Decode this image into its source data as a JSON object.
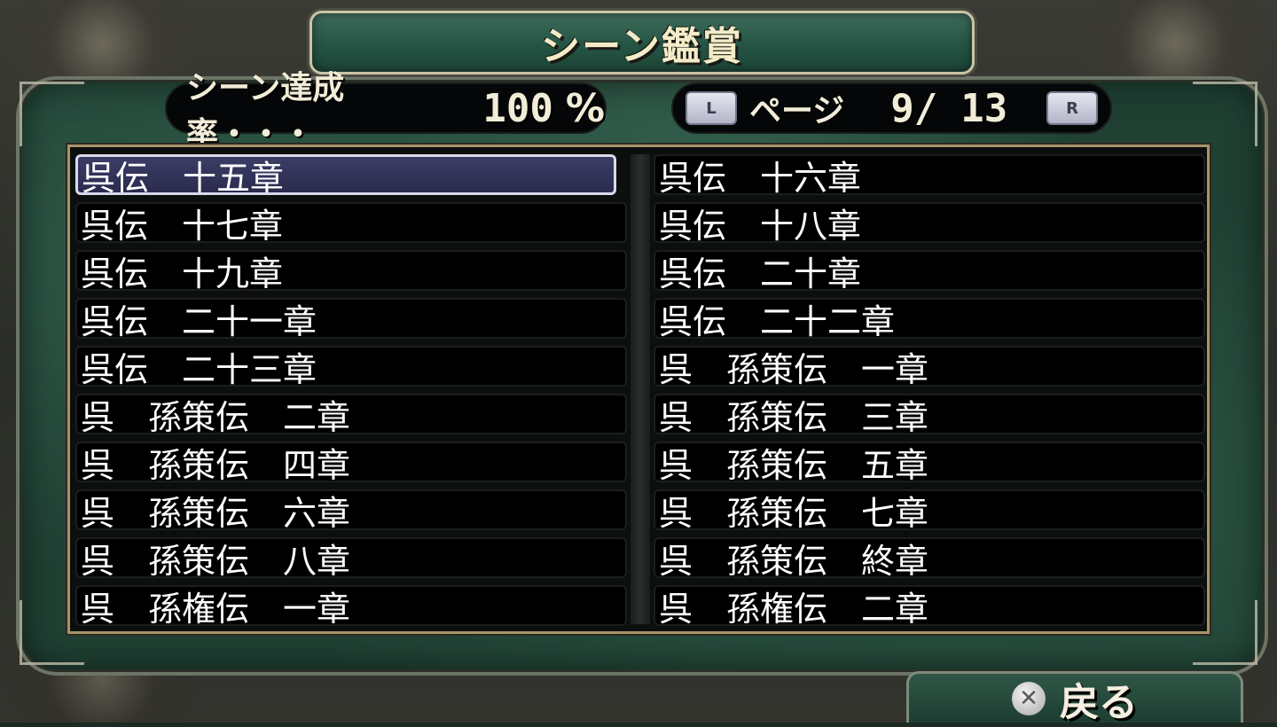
{
  "title": "シーン鑑賞",
  "completion": {
    "label": "シーン達成率・・・",
    "value": "100",
    "unit": "%"
  },
  "pagination": {
    "left_key": "L",
    "label": "ページ",
    "current": "9/",
    "total": "13",
    "right_key": "R"
  },
  "scenes": {
    "left": [
      "呉伝　十五章",
      "呉伝　十七章",
      "呉伝　十九章",
      "呉伝　二十一章",
      "呉伝　二十三章",
      "呉　孫策伝　二章",
      "呉　孫策伝　四章",
      "呉　孫策伝　六章",
      "呉　孫策伝　八章",
      "呉　孫権伝　一章"
    ],
    "right": [
      "呉伝　十六章",
      "呉伝　十八章",
      "呉伝　二十章",
      "呉伝　二十二章",
      "呉　孫策伝　一章",
      "呉　孫策伝　三章",
      "呉　孫策伝　五章",
      "呉　孫策伝　七章",
      "呉　孫策伝　終章",
      "呉　孫権伝　二章"
    ],
    "selected": "left.0"
  },
  "back": {
    "icon": "cross-button-icon",
    "label": "戻る"
  },
  "colors": {
    "panel_green": "#1f4033",
    "title_text": "#f4ecc9",
    "selection": "#2a2b4e",
    "frame_gold": "#a7936a"
  }
}
